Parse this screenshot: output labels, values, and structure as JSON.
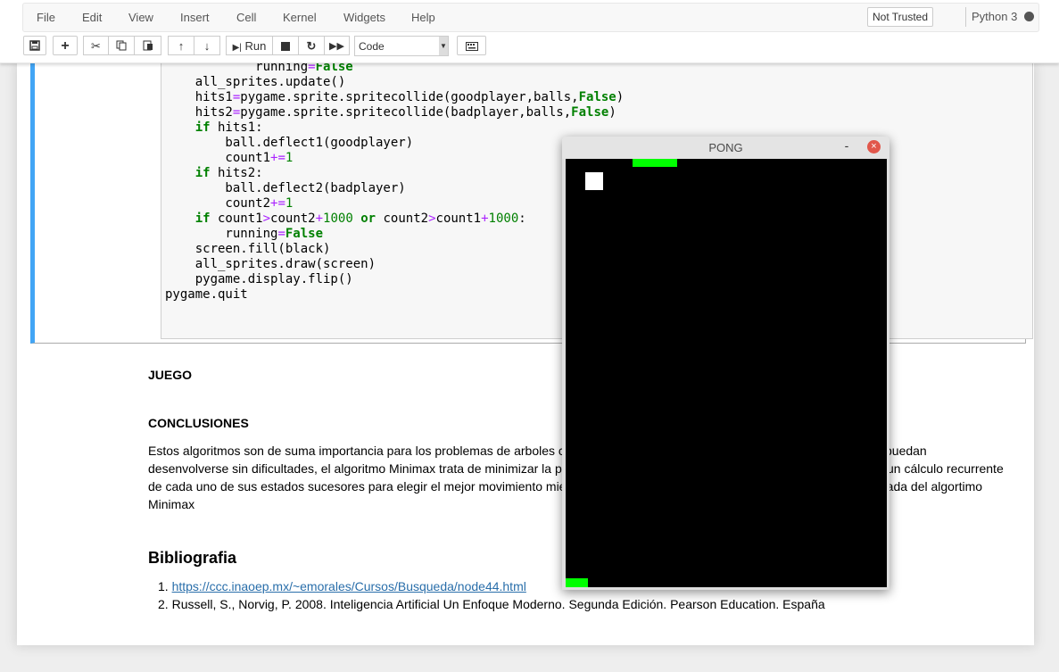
{
  "menu": {
    "items": [
      "File",
      "Edit",
      "View",
      "Insert",
      "Cell",
      "Kernel",
      "Widgets",
      "Help"
    ],
    "trust_status": "Not Trusted",
    "kernel": "Python 3"
  },
  "toolbar": {
    "run_label": "Run",
    "cell_type": "Code",
    "icons": [
      "save-icon",
      "plus-icon",
      "cut-icon",
      "copy-icon",
      "paste-icon",
      "arrow-up-icon",
      "arrow-down-icon",
      "run-icon",
      "stop-icon",
      "restart-icon",
      "fast-forward-icon",
      "keyboard-icon"
    ]
  },
  "code_lines": [
    "            running=False",
    "    all_sprites.update()",
    "    hits1=pygame.sprite.spritecollide(goodplayer,balls,False)",
    "    hits2=pygame.sprite.spritecollide(badplayer,balls,False)",
    "    if hits1:",
    "        ball.deflect1(goodplayer)",
    "        count1+=1",
    "    if hits2:",
    "        ball.deflect2(badplayer)",
    "        count2+=1",
    "    if count1>count2+1000 or count2>count1+1000:",
    "        running=False",
    "    screen.fill(black)",
    "    all_sprites.draw(screen)",
    "    pygame.display.flip()",
    "pygame.quit"
  ],
  "markdown": {
    "juego": "JUEGO",
    "conclusiones": "CONCLUSIONES",
    "para_lines": [
      "Estos algoritmos son de suma importancia para los problemas de arboles c",
      "puedan",
      "desenvolverse sin dificultades, el algoritmo Minimax trata de minimizar la p",
      "un cálculo recurrente",
      "de cada uno de sus estados sucesores para elegir el mejor movimiento mie",
      "rada del algortimo",
      "Minimax"
    ],
    "bibliografia": "Bibliografia",
    "refs": [
      "https://ccc.inaoep.mx/~emorales/Cursos/Busqueda/node44.html",
      "Russell, S., Norvig, P. 2008. Inteligencia Artificial Un Enfoque Moderno. Segunda Edición. Pearson Education. España"
    ]
  },
  "pong": {
    "title": "PONG",
    "minimize": "-",
    "close": "×"
  },
  "colors": {
    "accent": "#42a5f5",
    "paddle": "#00ff00",
    "link": "#296eaa"
  }
}
